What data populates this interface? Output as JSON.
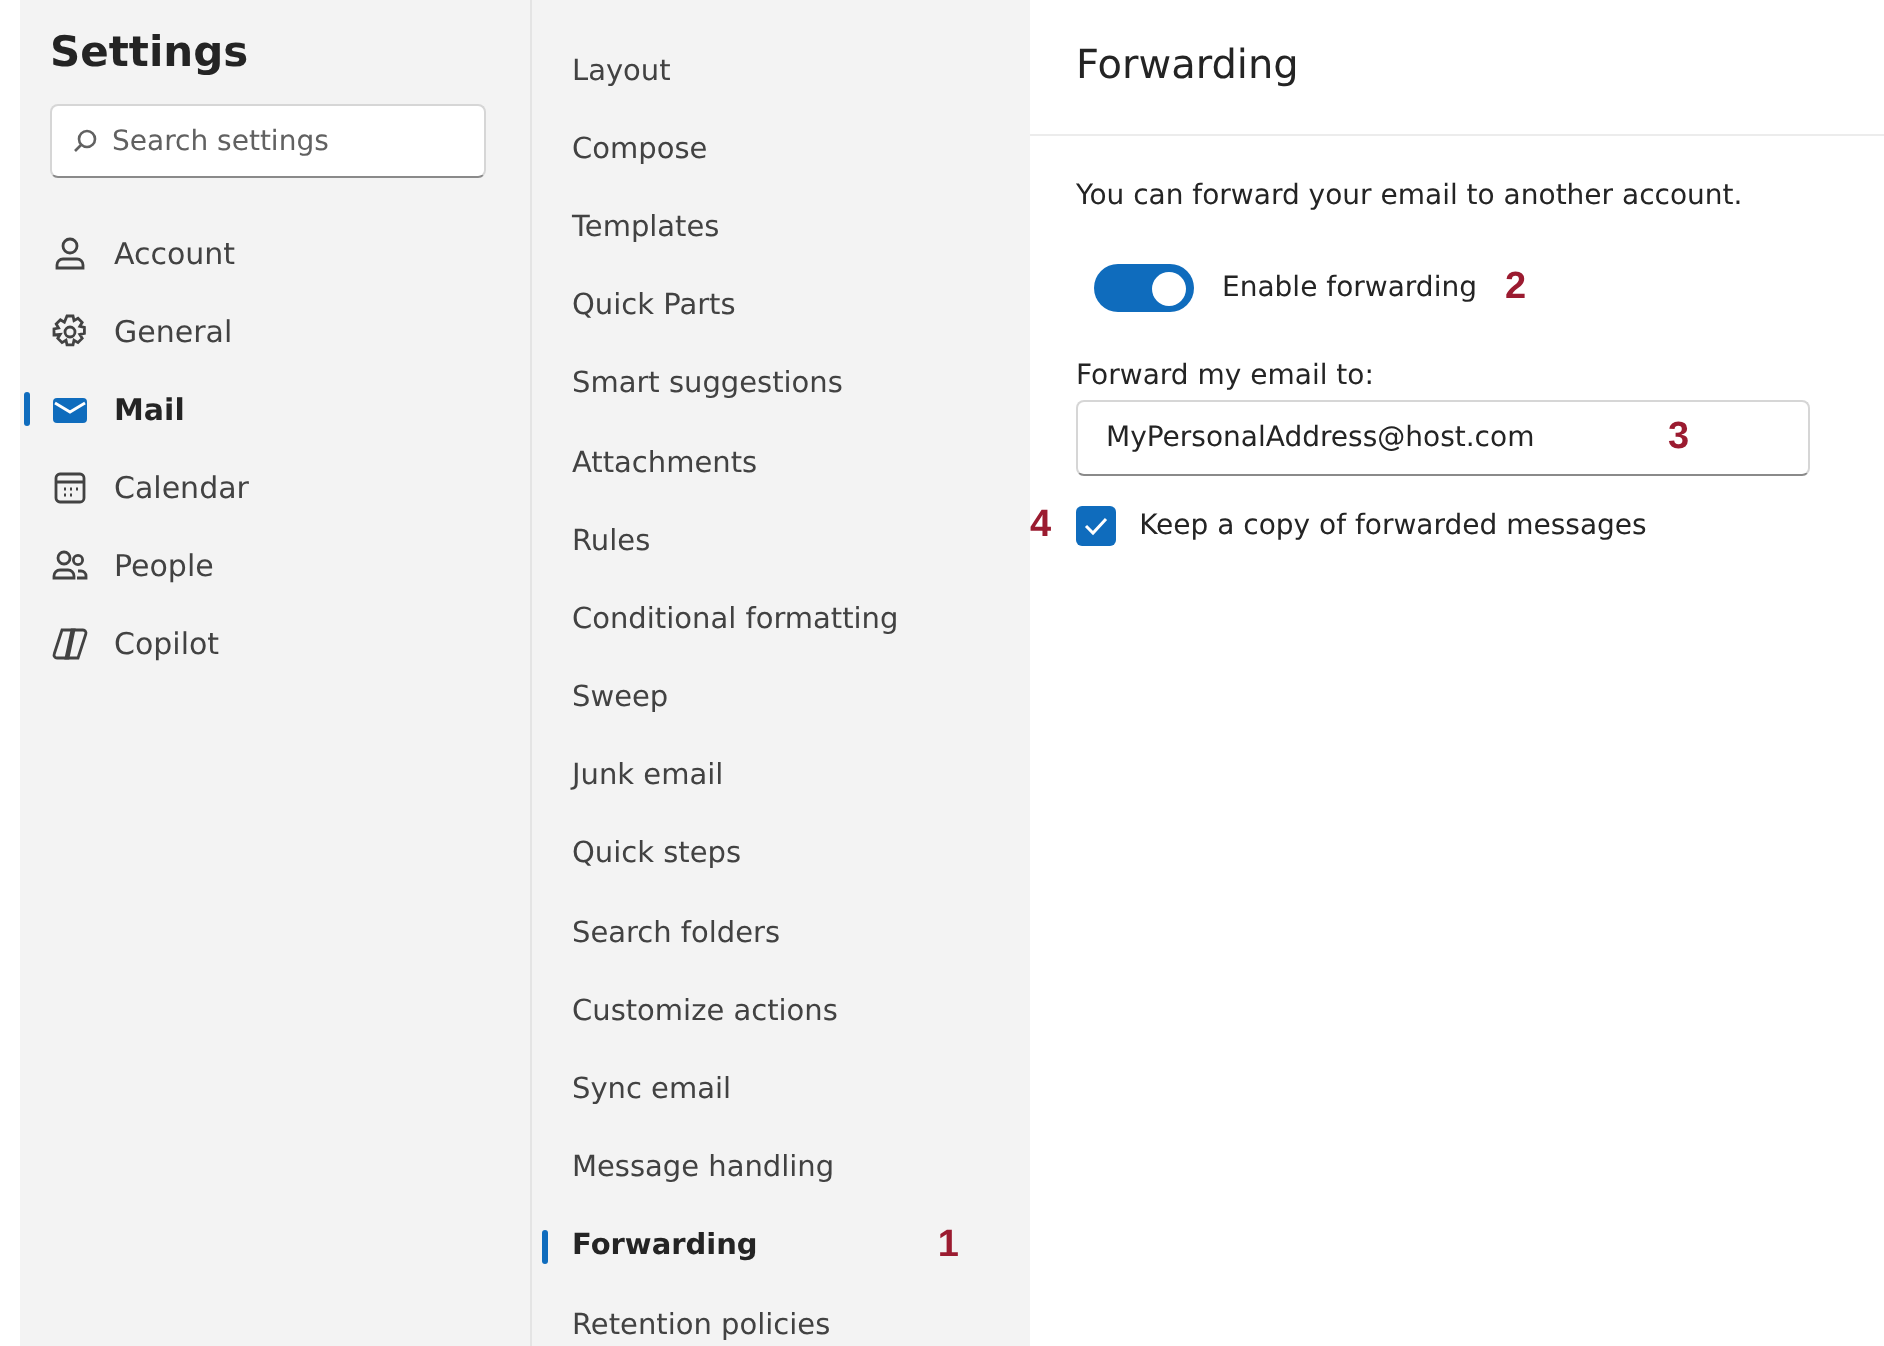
{
  "sidebar": {
    "title": "Settings",
    "search": {
      "placeholder": "Search settings"
    },
    "items": [
      {
        "label": "Account",
        "kind": "person",
        "selected": false
      },
      {
        "label": "General",
        "kind": "gear",
        "selected": false
      },
      {
        "label": "Mail",
        "kind": "mail",
        "selected": true
      },
      {
        "label": "Calendar",
        "kind": "calendar",
        "selected": false
      },
      {
        "label": "People",
        "kind": "people",
        "selected": false
      },
      {
        "label": "Copilot",
        "kind": "copilot",
        "selected": false
      }
    ]
  },
  "mail_menu": {
    "items": [
      {
        "label": "Layout",
        "selected": false
      },
      {
        "label": "Compose",
        "selected": false
      },
      {
        "label": "Templates",
        "selected": false
      },
      {
        "label": "Quick Parts",
        "selected": false
      },
      {
        "label": "Smart suggestions",
        "selected": false
      },
      {
        "label": "Attachments",
        "selected": false
      },
      {
        "label": "Rules",
        "selected": false
      },
      {
        "label": "Conditional formatting",
        "selected": false
      },
      {
        "label": "Sweep",
        "selected": false
      },
      {
        "label": "Junk email",
        "selected": false
      },
      {
        "label": "Quick steps",
        "selected": false
      },
      {
        "label": "Search folders",
        "selected": false
      },
      {
        "label": "Customize actions",
        "selected": false
      },
      {
        "label": "Sync email",
        "selected": false
      },
      {
        "label": "Message handling",
        "selected": false
      },
      {
        "label": "Forwarding",
        "selected": true,
        "callout": "1"
      },
      {
        "label": "Retention policies",
        "selected": false
      }
    ]
  },
  "panel": {
    "title": "Forwarding",
    "description": "You can forward your email to another account.",
    "toggle": {
      "label": "Enable forwarding",
      "on": true,
      "callout": "2"
    },
    "field": {
      "label": "Forward my email to:",
      "value": "MyPersonalAddress@host.com",
      "callout": "3"
    },
    "checkbox": {
      "label": "Keep a copy of forwarded messages",
      "checked": true,
      "callout": "4"
    }
  }
}
